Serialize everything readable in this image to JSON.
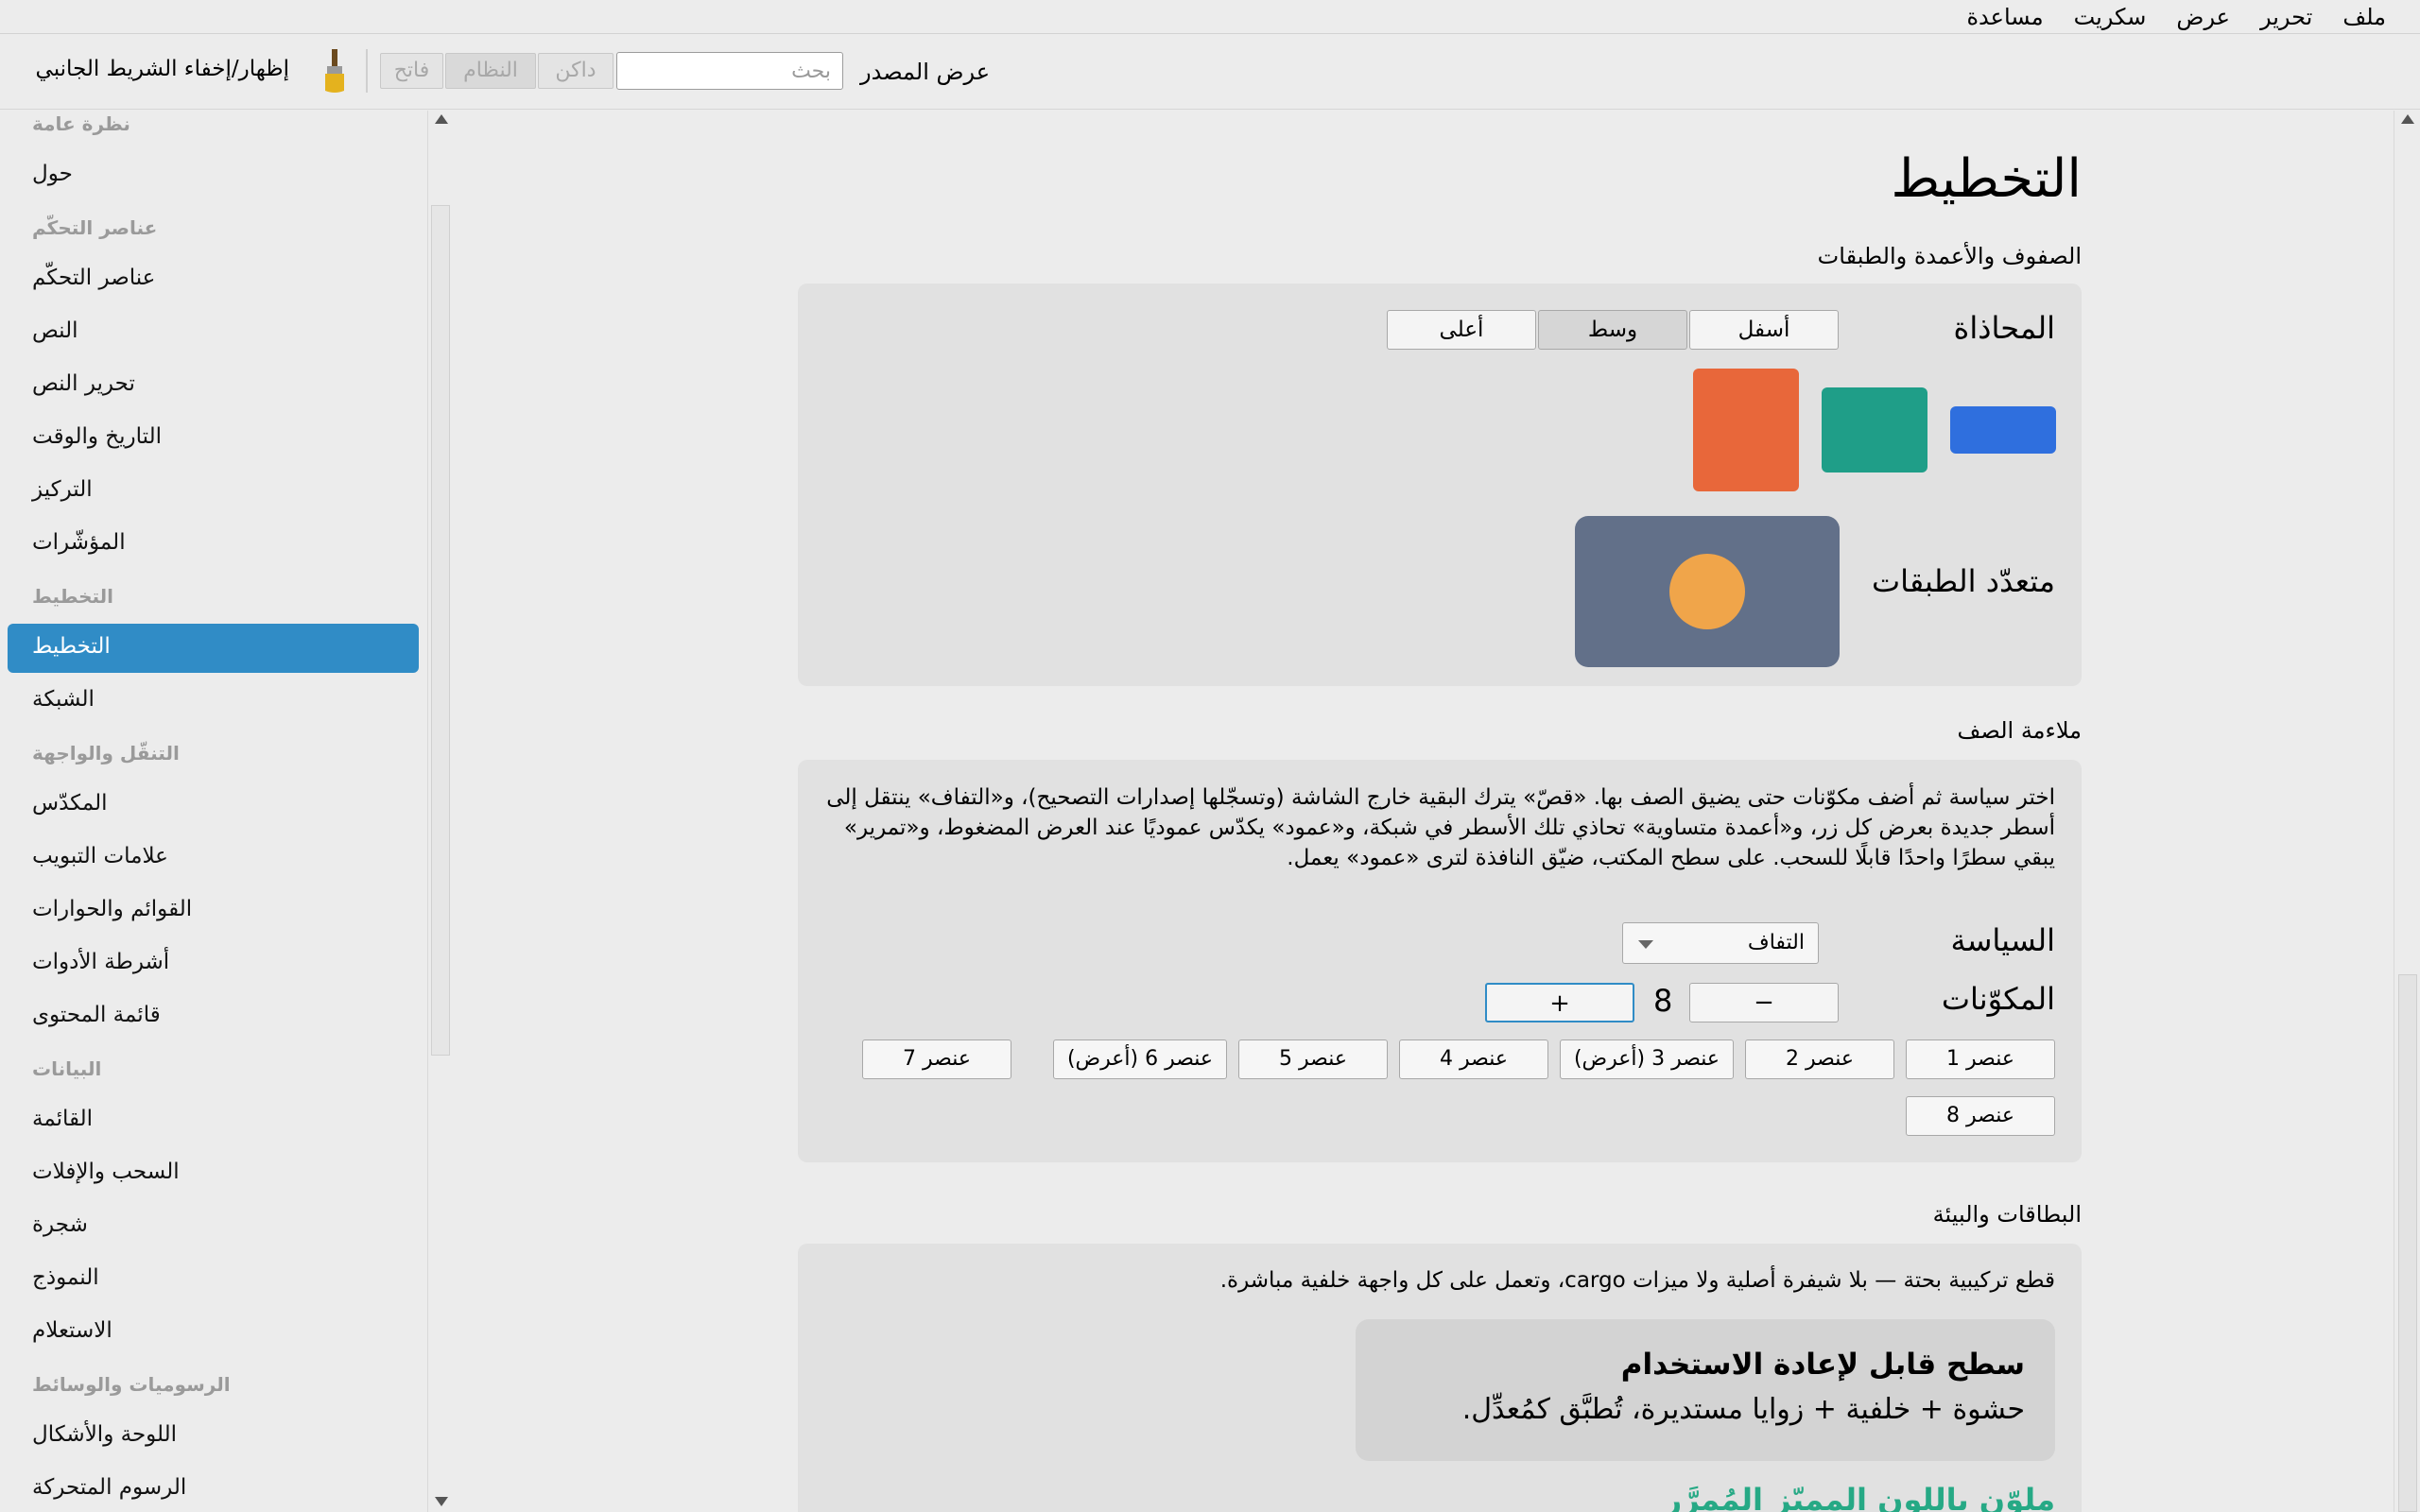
{
  "menubar": {
    "items": [
      "ملف",
      "تحرير",
      "عرض",
      "سكريت",
      "مساعدة"
    ]
  },
  "toolbar": {
    "toggle_sidebar_label": "إظهار/إخفاء الشريط الجانبي",
    "theme_light": "فاتح",
    "theme_system": "النظام",
    "theme_dark": "داكن",
    "search_placeholder": "بحث",
    "view_source_label": "عرض المصدر"
  },
  "sidebar": {
    "entries": [
      {
        "kind": "section",
        "label": "نظرة عامة"
      },
      {
        "kind": "item",
        "label": "حول"
      },
      {
        "kind": "section",
        "label": "عناصر التحكّم"
      },
      {
        "kind": "item",
        "label": "عناصر التحكّم"
      },
      {
        "kind": "item",
        "label": "النص"
      },
      {
        "kind": "item",
        "label": "تحرير النص"
      },
      {
        "kind": "item",
        "label": "التاريخ والوقت"
      },
      {
        "kind": "item",
        "label": "التركيز"
      },
      {
        "kind": "item",
        "label": "المؤشّرات"
      },
      {
        "kind": "section",
        "label": "التخطيط"
      },
      {
        "kind": "item",
        "label": "التخطيط",
        "active": true
      },
      {
        "kind": "item",
        "label": "الشبكة"
      },
      {
        "kind": "section",
        "label": "التنقّل والواجهة"
      },
      {
        "kind": "item",
        "label": "المكدّس"
      },
      {
        "kind": "item",
        "label": "علامات التبويب"
      },
      {
        "kind": "item",
        "label": "القوائم والحوارات"
      },
      {
        "kind": "item",
        "label": "أشرطة الأدوات"
      },
      {
        "kind": "item",
        "label": "قائمة المحتوى"
      },
      {
        "kind": "section",
        "label": "البيانات"
      },
      {
        "kind": "item",
        "label": "القائمة"
      },
      {
        "kind": "item",
        "label": "السحب والإفلات"
      },
      {
        "kind": "item",
        "label": "شجرة"
      },
      {
        "kind": "item",
        "label": "النموذج"
      },
      {
        "kind": "item",
        "label": "الاستعلام"
      },
      {
        "kind": "section",
        "label": "الرسوميات والوسائط"
      },
      {
        "kind": "item",
        "label": "اللوحة والأشكال"
      },
      {
        "kind": "item",
        "label": "الرسوم المتحركة"
      }
    ]
  },
  "page": {
    "title": "التخطيط",
    "section1": {
      "title": "الصفوف والأعمدة والطبقات",
      "alignment_label": "المحاذاة",
      "align_bottom": "أسفل",
      "align_middle": "وسط",
      "align_top": "أعلى",
      "layers_label": "متعدّد الطبقات",
      "colors": {
        "blue": "#2f6fde",
        "teal": "#1f9e88",
        "orange": "#e8673a",
        "slate": "#627089",
        "amber": "#f0a54a"
      }
    },
    "section2": {
      "title": "ملاءمة الصف",
      "description": "اختر سياسة ثم أضف مكوّنات حتى يضيق الصف بها. «قصّ» يترك البقية خارج الشاشة (وتسجّلها إصدارات التصحيح)، و«التفاف» ينتقل إلى أسطر جديدة بعرض كل زر، و«أعمدة متساوية» تحاذي تلك الأسطر في شبكة، و«عمود» يكدّس عموديًا عند العرض المضغوط، و«تمرير» يبقي سطرًا واحدًا قابلًا للسحب. على سطح المكتب، ضيّق النافذة لترى «عمود» يعمل.",
      "policy_label": "السياسة",
      "policy_value": "التفاف",
      "components_label": "المكوّنات",
      "minus": "−",
      "plus": "+",
      "count": "8",
      "items": [
        "عنصر 1",
        "عنصر 2",
        "عنصر 3 (أعرض)",
        "عنصر 4",
        "عنصر 5",
        "عنصر 6 (أعرض)",
        "عنصر 7",
        "عنصر 8"
      ]
    },
    "section3": {
      "title": "البطاقات والبيئة",
      "line": "قطع تركيبية بحتة — بلا شيفرة أصلية ولا ميزات cargo، وتعمل على كل واجهة خلفية مباشرة.",
      "surface_title": "سطح قابل لإعادة الاستخدام",
      "surface_sub": "حشوة + خلفية + زوايا مستديرة، تُطبَّق كمُعدِّل.",
      "accent_text": "ملوّن باللون المميّز المُمرَّر"
    }
  }
}
